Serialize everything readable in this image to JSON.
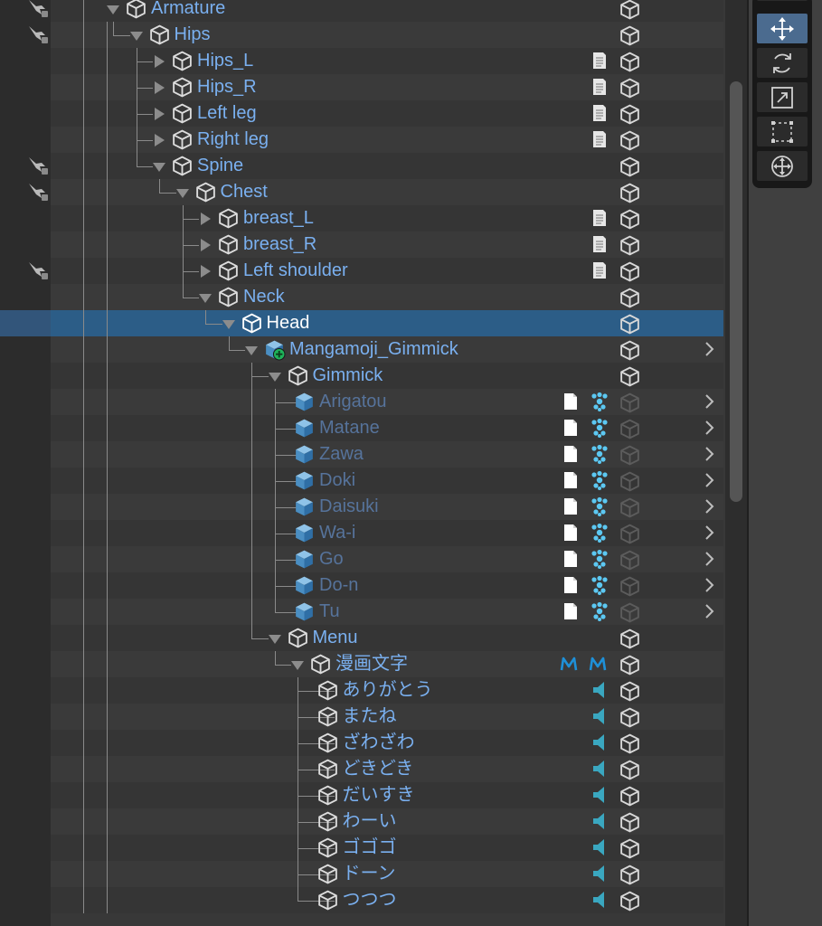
{
  "outliner": {
    "rows": [
      {
        "label": "Armature",
        "indent": 4,
        "expand": "down",
        "icon": "cube",
        "pose": true,
        "right": []
      },
      {
        "label": "Hips",
        "indent": 5,
        "expand": "down",
        "icon": "cube",
        "pose": true,
        "right": []
      },
      {
        "label": "Hips_L",
        "indent": 6,
        "expand": "right",
        "icon": "cube",
        "right": [
          "script"
        ]
      },
      {
        "label": "Hips_R",
        "indent": 6,
        "expand": "right",
        "icon": "cube",
        "right": [
          "script"
        ]
      },
      {
        "label": "Left leg",
        "indent": 6,
        "expand": "right",
        "icon": "cube",
        "right": [
          "script"
        ]
      },
      {
        "label": "Right leg",
        "indent": 6,
        "expand": "right",
        "icon": "cube",
        "right": [
          "script"
        ]
      },
      {
        "label": "Spine",
        "indent": 6,
        "expand": "down",
        "icon": "cube",
        "pose": true,
        "right": []
      },
      {
        "label": "Chest",
        "indent": 7,
        "expand": "down",
        "icon": "cube",
        "pose": true,
        "right": []
      },
      {
        "label": "breast_L",
        "indent": 8,
        "expand": "right",
        "icon": "cube",
        "right": [
          "script"
        ]
      },
      {
        "label": "breast_R",
        "indent": 8,
        "expand": "right",
        "icon": "cube",
        "right": [
          "script"
        ]
      },
      {
        "label": "Left shoulder",
        "indent": 8,
        "expand": "right",
        "icon": "cube",
        "pose": true,
        "right": [
          "script"
        ]
      },
      {
        "label": "Neck",
        "indent": 8,
        "expand": "down",
        "icon": "cube",
        "right": []
      },
      {
        "label": "Head",
        "indent": 9,
        "expand": "down",
        "icon": "cube",
        "selected": true,
        "right": []
      },
      {
        "label": "Mangamoji_Gimmick",
        "indent": 10,
        "expand": "down",
        "icon": "prefab-add",
        "right": [],
        "chevron": true
      },
      {
        "label": "Gimmick",
        "indent": 11,
        "expand": "down",
        "icon": "cube",
        "right": []
      },
      {
        "label": "Arigatou",
        "indent": 12,
        "icon": "prefab",
        "dim": true,
        "right": [
          "doc",
          "particle"
        ],
        "chevron": true
      },
      {
        "label": "Matane",
        "indent": 12,
        "icon": "prefab",
        "dim": true,
        "right": [
          "doc",
          "particle"
        ],
        "chevron": true
      },
      {
        "label": "Zawa",
        "indent": 12,
        "icon": "prefab",
        "dim": true,
        "right": [
          "doc",
          "particle"
        ],
        "chevron": true
      },
      {
        "label": "Doki",
        "indent": 12,
        "icon": "prefab",
        "dim": true,
        "right": [
          "doc",
          "particle"
        ],
        "chevron": true
      },
      {
        "label": "Daisuki",
        "indent": 12,
        "icon": "prefab",
        "dim": true,
        "right": [
          "doc",
          "particle"
        ],
        "chevron": true
      },
      {
        "label": "Wa-i",
        "indent": 12,
        "icon": "prefab",
        "dim": true,
        "right": [
          "doc",
          "particle"
        ],
        "chevron": true
      },
      {
        "label": "Go",
        "indent": 12,
        "icon": "prefab",
        "dim": true,
        "right": [
          "doc",
          "particle"
        ],
        "chevron": true
      },
      {
        "label": "Do-n",
        "indent": 12,
        "icon": "prefab",
        "dim": true,
        "right": [
          "doc",
          "particle"
        ],
        "chevron": true
      },
      {
        "label": "Tu",
        "indent": 12,
        "icon": "prefab",
        "dim": true,
        "right": [
          "doc",
          "particle"
        ],
        "chevron": true
      },
      {
        "label": "Menu",
        "indent": 11,
        "expand": "down",
        "icon": "cube",
        "right": []
      },
      {
        "label": "漫画文字",
        "indent": 12,
        "expand": "down",
        "icon": "cube",
        "right": [
          "mesh",
          "mesh"
        ]
      },
      {
        "label": "ありがとう",
        "indent": 13,
        "icon": "cube",
        "right": [
          "audio"
        ]
      },
      {
        "label": "またね",
        "indent": 13,
        "icon": "cube",
        "right": [
          "audio"
        ]
      },
      {
        "label": "ざわざわ",
        "indent": 13,
        "icon": "cube",
        "right": [
          "audio"
        ]
      },
      {
        "label": "どきどき",
        "indent": 13,
        "icon": "cube",
        "right": [
          "audio"
        ]
      },
      {
        "label": "だいすき",
        "indent": 13,
        "icon": "cube",
        "right": [
          "audio"
        ]
      },
      {
        "label": "わーい",
        "indent": 13,
        "icon": "cube",
        "right": [
          "audio"
        ]
      },
      {
        "label": "ゴゴゴ",
        "indent": 13,
        "icon": "cube",
        "right": [
          "audio"
        ]
      },
      {
        "label": "ドーン",
        "indent": 13,
        "icon": "cube",
        "right": [
          "audio"
        ]
      },
      {
        "label": "つつつ",
        "indent": 13,
        "icon": "cube",
        "right": [
          "audio"
        ]
      }
    ]
  },
  "tools": [
    {
      "name": "move-tool",
      "icon": "move-icon",
      "active": true
    },
    {
      "name": "rotate-tool",
      "icon": "rotate-icon",
      "active": false
    },
    {
      "name": "scale-tool",
      "icon": "scale-icon",
      "active": false
    },
    {
      "name": "rect-tool",
      "icon": "rect-icon",
      "active": false
    },
    {
      "name": "transform-tool",
      "icon": "transform-icon",
      "active": false
    }
  ],
  "colors": {
    "label": "#7ab0f0",
    "label_dim": "#56739b",
    "selection": "#2c5d87",
    "accent_blue": "#1e90d8",
    "audio_teal": "#3aa7c0"
  }
}
